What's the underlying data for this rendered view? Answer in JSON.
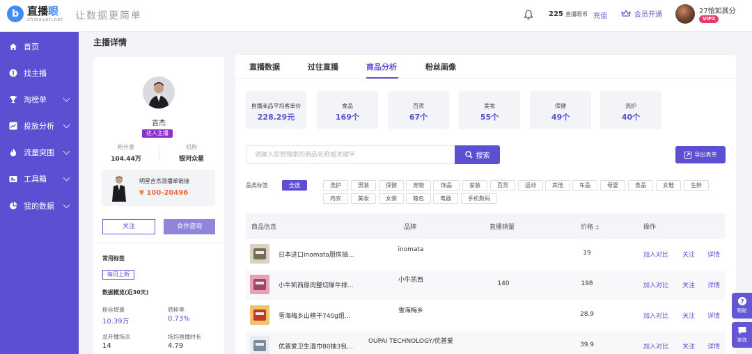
{
  "brand": {
    "name_main": "直播",
    "name_accent": "眼",
    "url": "zhiboyan.net",
    "logo_letter": "b",
    "slogan": "让数据更简单"
  },
  "header": {
    "coins_count": "225",
    "coins_label": "直播眼币",
    "recharge": "充值",
    "vip_open": "会员开通",
    "user_name": "27恰如其分",
    "vip_level": "VIP3"
  },
  "sidebar": {
    "items": [
      {
        "label": "首页",
        "icon": "home-icon",
        "has_caret": false
      },
      {
        "label": "找主播",
        "icon": "info-circle-icon",
        "has_caret": false
      },
      {
        "label": "淘榜单",
        "icon": "trophy-icon",
        "has_caret": true
      },
      {
        "label": "投放分析",
        "icon": "chart-icon",
        "has_caret": true
      },
      {
        "label": "流量突围",
        "icon": "flame-icon",
        "has_caret": true
      },
      {
        "label": "工具箱",
        "icon": "toolbox-icon",
        "has_caret": true
      },
      {
        "label": "我的数据",
        "icon": "pie-icon",
        "has_caret": true
      }
    ]
  },
  "page": {
    "title": "主播详情"
  },
  "profile": {
    "name": "吉杰",
    "tag": "达人主播",
    "fans_label": "粉丝量",
    "fans_value": "104.44万",
    "org_label": "机构",
    "org_value": "银河众星",
    "product_title": "明星吉杰混播单链接",
    "product_price": "¥ 100-20496",
    "follow_btn": "关注",
    "consult_btn": "合作咨询",
    "tags_title": "常用标签",
    "daily_tag": "每日上新",
    "overview_title": "数据概览(近30天)",
    "metrics": [
      {
        "label": "粉丝增量",
        "value": "10.39万"
      },
      {
        "label": "转粉率",
        "value": "0.73%"
      },
      {
        "label": "总开播场次",
        "value": "14"
      },
      {
        "label": "场均直播时长",
        "value": "4.79"
      }
    ]
  },
  "tabs": [
    {
      "label": "直播数据",
      "active": false
    },
    {
      "label": "过往直播",
      "active": false
    },
    {
      "label": "商品分析",
      "active": true
    },
    {
      "label": "粉丝画像",
      "active": false
    }
  ],
  "category_cards": [
    {
      "label": "直播商品平均客单价",
      "value": "228.29元"
    },
    {
      "label": "食品",
      "value": "169个"
    },
    {
      "label": "百货",
      "value": "67个"
    },
    {
      "label": "美妆",
      "value": "55个"
    },
    {
      "label": "保健",
      "value": "49个"
    },
    {
      "label": "洗护",
      "value": "40个"
    }
  ],
  "search": {
    "placeholder": "请输入您想搜索的商品名称或关键字",
    "value": "",
    "button": "搜索",
    "export": "导出表单"
  },
  "filters": {
    "label": "品类标签",
    "row1": [
      "全选",
      "洗护",
      "男装",
      "保健",
      "宠物",
      "饰品",
      "家装",
      "百货",
      "运动",
      "其他",
      "车品",
      "母婴",
      "食品",
      "女鞋",
      "生鲜"
    ],
    "row2": [
      "内衣",
      "美妆",
      "女装",
      "箱包",
      "电器",
      "手机数码"
    ]
  },
  "table": {
    "headers": {
      "info": "商品信息",
      "brand": "品牌",
      "sales": "直播销量",
      "price": "价格",
      "ops": "操作"
    },
    "actions": {
      "compare": "加入对比",
      "follow": "关注",
      "detail": "详情"
    },
    "rows": [
      {
        "name": "日本进口inomata厨房抽...",
        "brand": "inomata",
        "sales": "",
        "price": "19"
      },
      {
        "name": "小牛凯西原肉整切厚牛排...",
        "brand": "小牛凯西",
        "sales": "140",
        "price": "198"
      },
      {
        "name": "雪海梅乡山楂干740g组...",
        "brand": "雪海梅乡",
        "sales": "",
        "price": "28.9"
      },
      {
        "name": "优普爱卫生湿巾80抽3包...",
        "brand": "OUPAI TECHNOLOGY/优普爱",
        "sales": "",
        "price": "39.9"
      }
    ]
  },
  "float": {
    "help": "帮助",
    "consult": "咨询"
  },
  "colors": {
    "accent": "#5c4fd1",
    "price_orange": "#ef6a3b",
    "vip_red": "#e63c6a"
  }
}
